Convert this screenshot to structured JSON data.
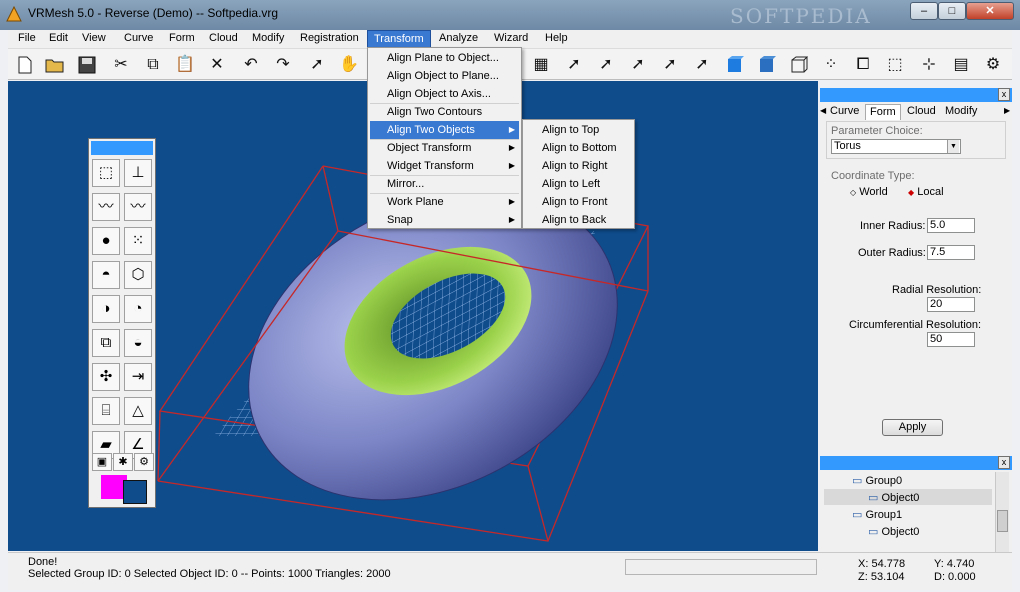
{
  "window": {
    "title": "VRMesh 5.0 - Reverse (Demo) -- Softpedia.vrg",
    "watermark": "SOFTPEDIA",
    "btn_min": "–",
    "btn_max": "□",
    "btn_close": "✕"
  },
  "menubar": [
    "File",
    "Edit",
    "View",
    "Curve",
    "Form",
    "Cloud",
    "Modify",
    "Registration",
    "Transform",
    "Analyze",
    "Wizard",
    "Help"
  ],
  "transform_menu": {
    "items": [
      "Align Plane to Object...",
      "Align Object to Plane...",
      "Align Object to Axis...",
      "Align Two Contours",
      "Align Two Objects",
      "Object Transform",
      "Widget Transform",
      "Mirror...",
      "Work Plane",
      "Snap"
    ],
    "highlighted": "Align Two Objects"
  },
  "submenu": {
    "items": [
      "Align to Top",
      "Align to Bottom",
      "Align to Right",
      "Align to Left",
      "Align to Front",
      "Align to Back"
    ]
  },
  "panel": {
    "tabs": [
      "Curve",
      "Form",
      "Cloud",
      "Modify"
    ],
    "selected_tab": "Form",
    "param_choice_label": "Parameter Choice:",
    "param_choice_value": "Torus",
    "coord_type_label": "Coordinate Type:",
    "coord_world": "World",
    "coord_local": "Local",
    "inner_radius_label": "Inner Radius:",
    "inner_radius": "5.0",
    "outer_radius_label": "Outer Radius:",
    "outer_radius": "7.5",
    "radial_res_label": "Radial Resolution:",
    "radial_res": "20",
    "circ_res_label": "Circumferential Resolution:",
    "circ_res": "50",
    "apply": "Apply",
    "close": "x"
  },
  "tree": {
    "nodes": [
      "Group0",
      "Object0",
      "Group1",
      "Object0"
    ],
    "close": "x"
  },
  "status": {
    "line1": "Done!",
    "line2": "Selected Group ID: 0   Selected Object ID: 0  -- Points: 1000  Triangles: 2000",
    "x": "X: 54.778",
    "y": "Y: 4.740",
    "z": "Z: 53.104",
    "d": "D: 0.000"
  },
  "colors": {
    "viewport": "#0f4c8c",
    "torus": "#7c85c6",
    "torus_inner": "#8ac03e",
    "bbox": "#c62828",
    "menu_highlight": "#3a79d2"
  }
}
